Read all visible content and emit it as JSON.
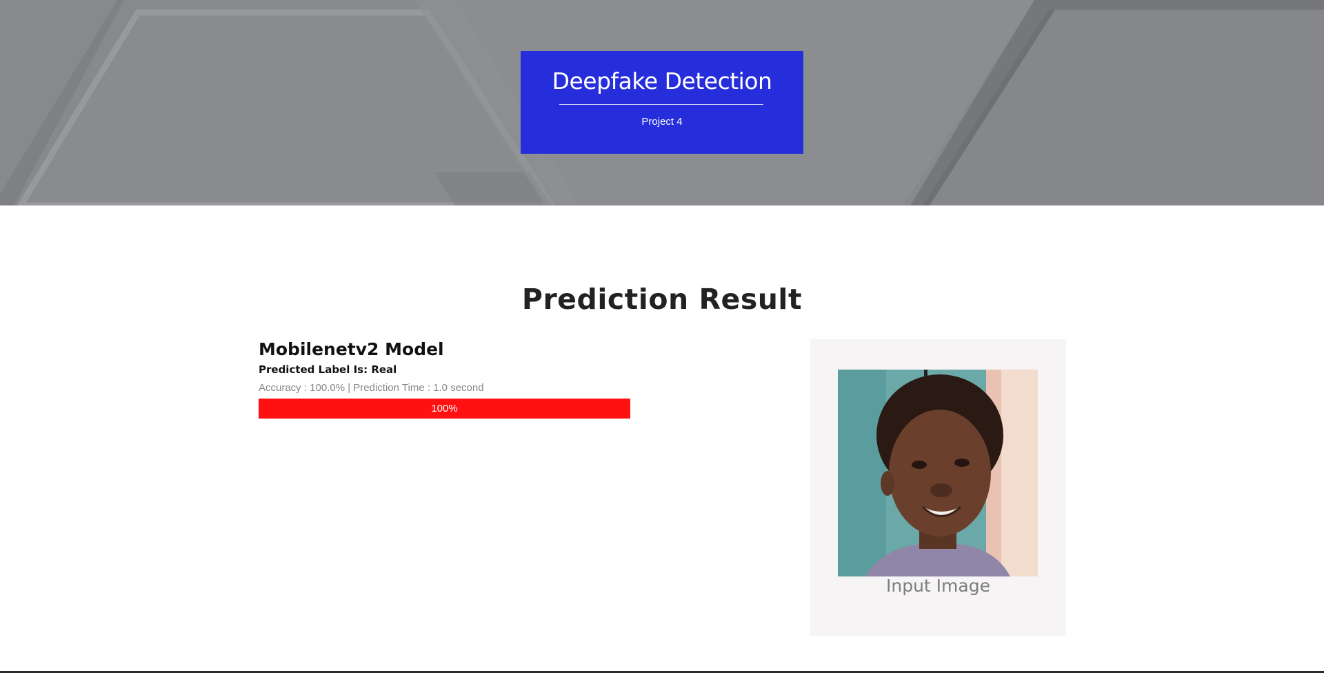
{
  "header": {
    "title": "Deepfake Detection",
    "subtitle": "Project 4"
  },
  "result": {
    "heading": "Prediction Result",
    "model_name": "Mobilenetv2 Model",
    "predicted_label": "Predicted Label Is: Real",
    "meta": "Accuracy : 100.0% | Prediction Time : 1.0 second",
    "progress_label": "100%",
    "progress_value": 1.0,
    "progress_color": "#ff1111"
  },
  "input_image": {
    "caption": "Input Image",
    "icon": "face-photo"
  },
  "colors": {
    "hero_background": "#88898d",
    "title_card": "#262ddb",
    "card_background": "#f6f4f4"
  }
}
